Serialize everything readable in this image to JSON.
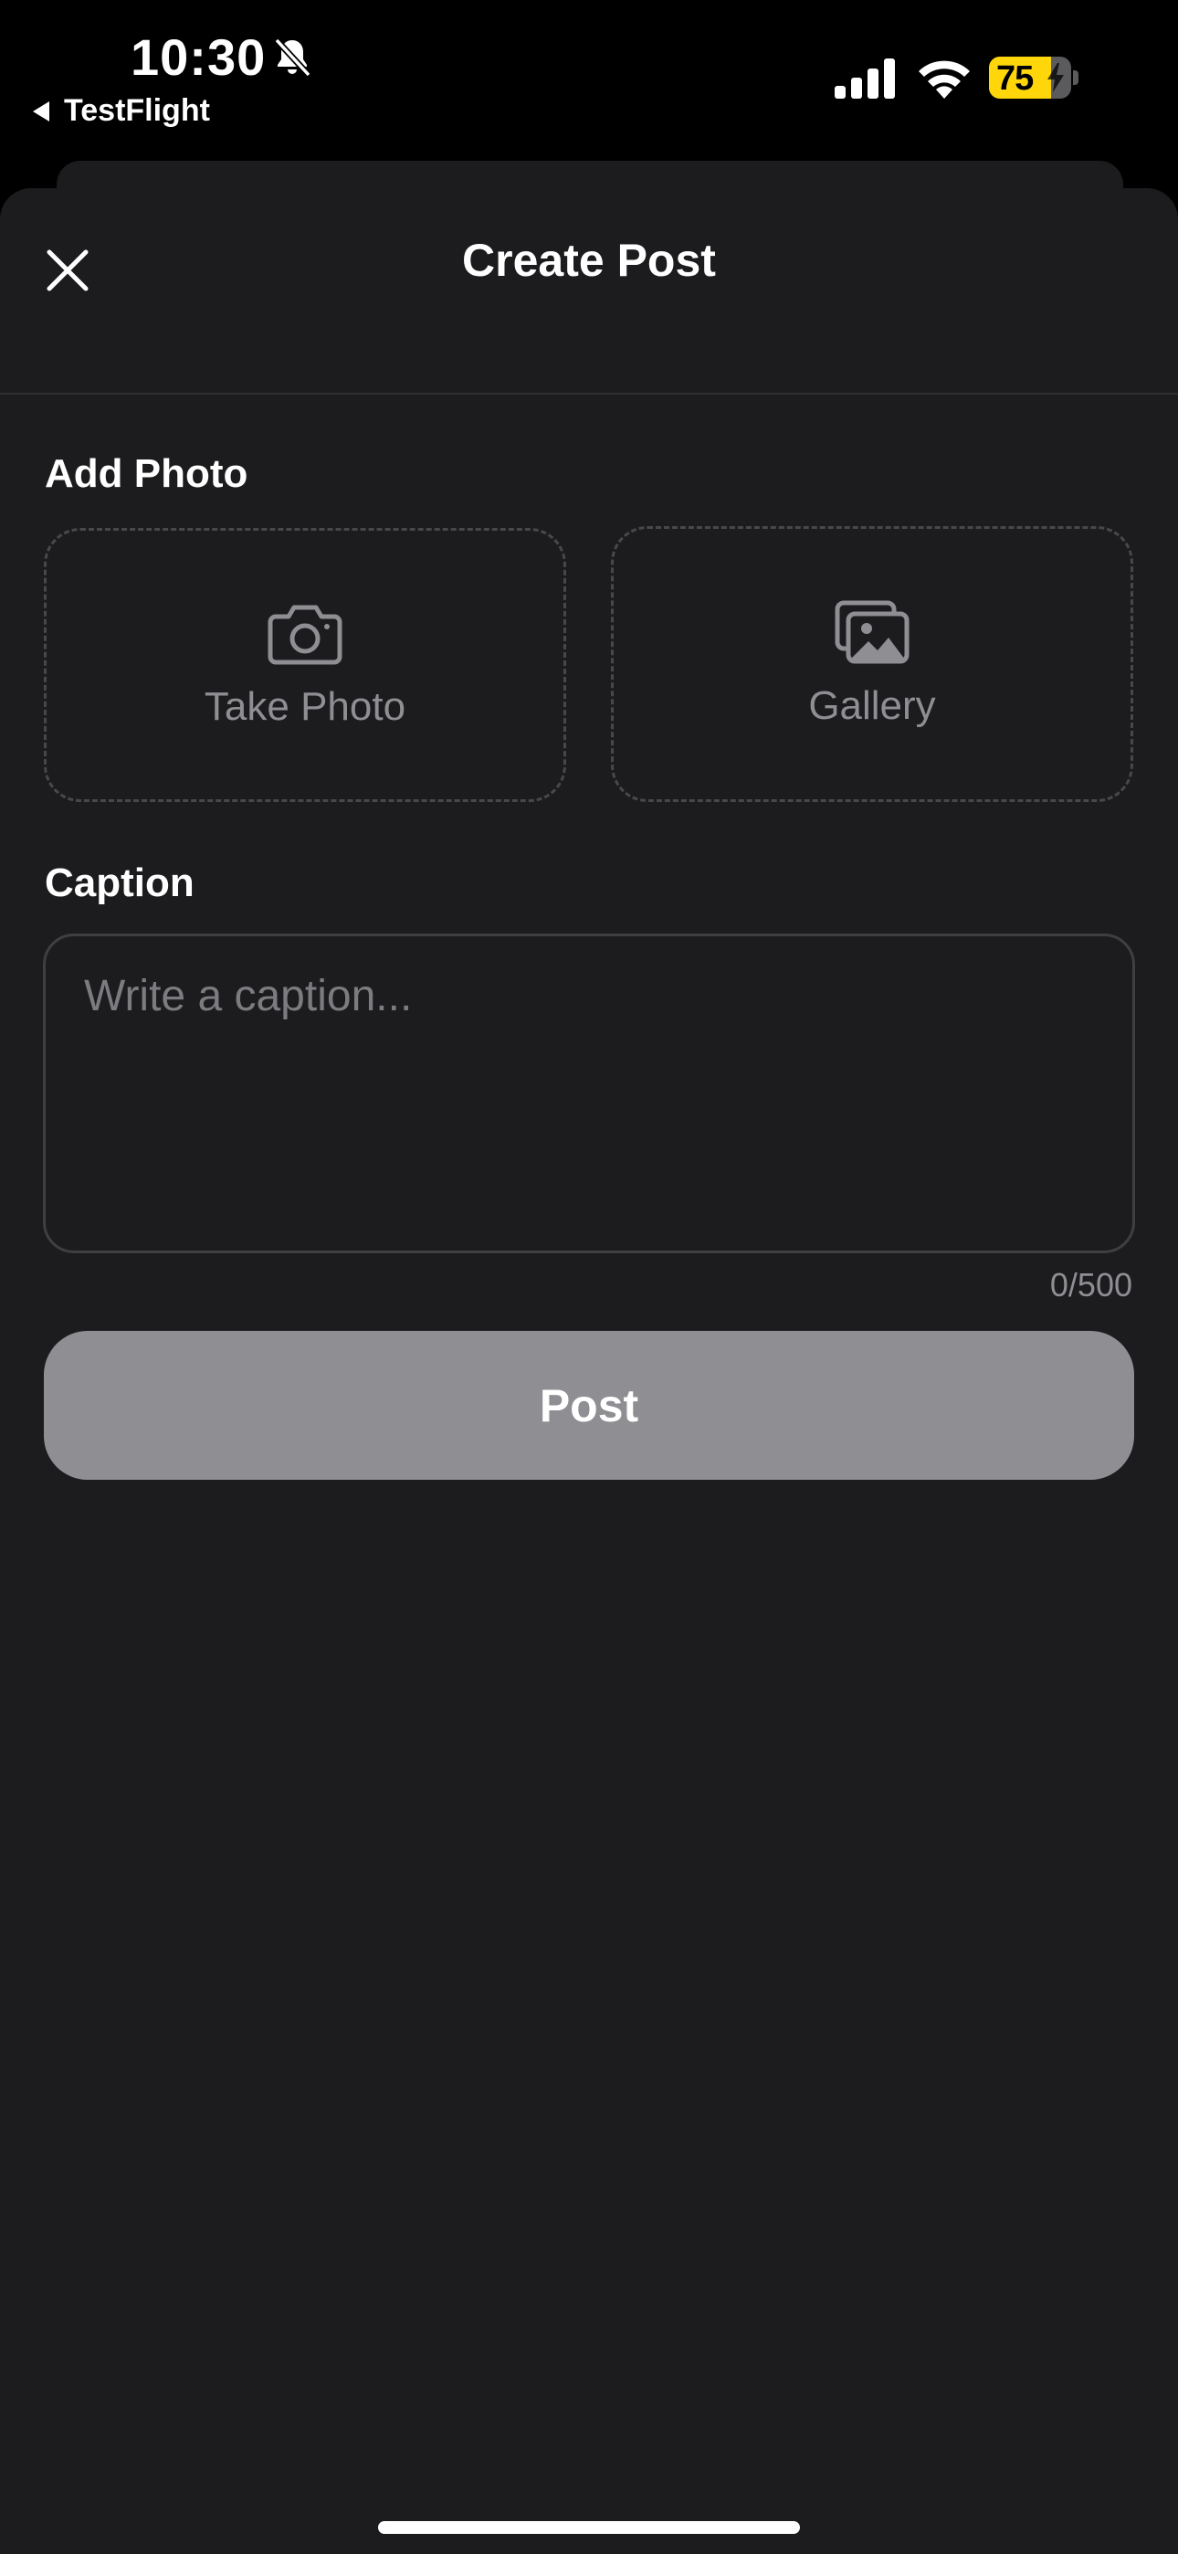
{
  "status_bar": {
    "time": "10:30",
    "back_app": "TestFlight",
    "battery_level": "75",
    "battery_fraction": 0.75,
    "battery_color": "#ffd60a",
    "icons": [
      "bell-slash-icon",
      "cellular-signal-icon",
      "wifi-icon",
      "battery-icon",
      "charging-bolt-icon"
    ]
  },
  "header": {
    "title": "Create Post",
    "close_icon": "close-icon"
  },
  "add_photo": {
    "label": "Add Photo",
    "options": [
      {
        "label": "Take Photo",
        "icon": "camera-icon"
      },
      {
        "label": "Gallery",
        "icon": "gallery-icon"
      }
    ]
  },
  "caption": {
    "label": "Caption",
    "placeholder": "Write a caption...",
    "value": "",
    "char_count": "0/500"
  },
  "post_button": {
    "label": "Post",
    "color": "#8e8e93"
  },
  "theme": {
    "background": "#1c1c1e",
    "accent_text": "#ffffff",
    "muted_text": "#8e8e93"
  }
}
